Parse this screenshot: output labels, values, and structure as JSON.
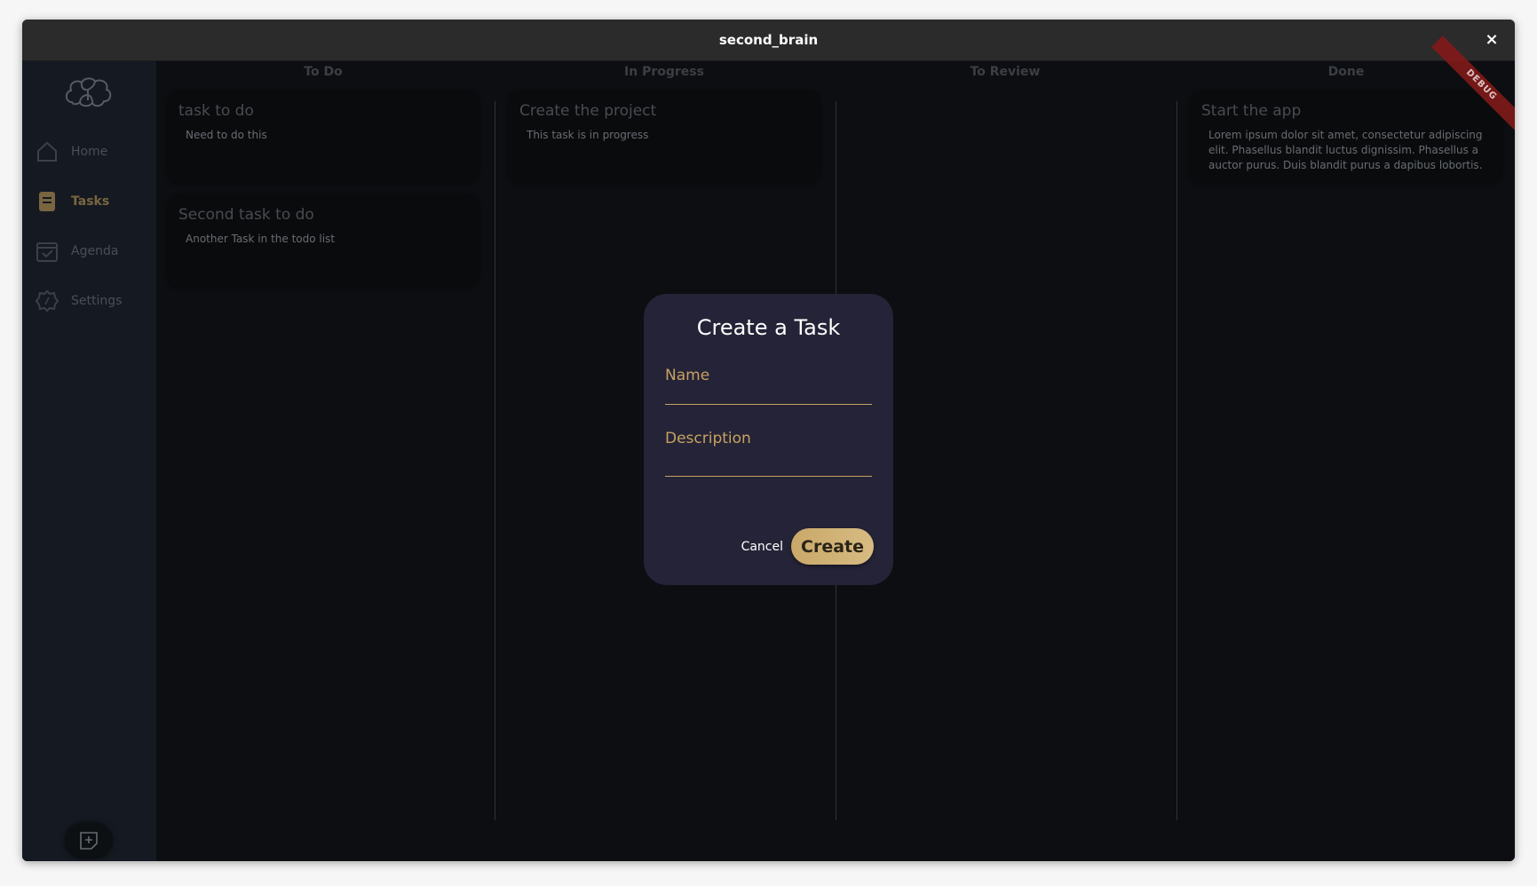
{
  "window": {
    "title": "second_brain",
    "close_symbol": "×"
  },
  "sidebar": {
    "items": [
      {
        "label": "Home",
        "icon": "home-icon"
      },
      {
        "label": "Tasks",
        "icon": "tasks-icon",
        "active": true
      },
      {
        "label": "Agenda",
        "icon": "calendar-icon"
      },
      {
        "label": "Settings",
        "icon": "settings-icon"
      }
    ],
    "add_button_icon": "add-note-icon"
  },
  "board": {
    "columns": [
      {
        "title": "To Do",
        "cards": [
          {
            "title": "task to do",
            "desc": "Need to do this"
          },
          {
            "title": "Second task to do",
            "desc": "Another Task in the todo list"
          }
        ]
      },
      {
        "title": "In Progress",
        "cards": [
          {
            "title": "Create the project",
            "desc": "This task is in progress"
          }
        ]
      },
      {
        "title": "To Review",
        "cards": []
      },
      {
        "title": "Done",
        "cards": [
          {
            "title": "Start the app",
            "desc": "Lorem ipsum dolor sit amet, consectetur adipiscing elit. Phasellus blandit luctus dignissim. Phasellus a auctor purus. Duis blandit purus a dapibus lobortis."
          }
        ]
      }
    ]
  },
  "debug_banner": "DEBUG",
  "dialog": {
    "title": "Create a Task",
    "name_label": "Name",
    "name_value": "",
    "description_label": "Description",
    "description_value": "",
    "cancel_label": "Cancel",
    "create_label": "Create"
  },
  "colors": {
    "accent": "#c7a260",
    "dialog_bg": "#252337",
    "sidebar_bg": "#161b23"
  }
}
